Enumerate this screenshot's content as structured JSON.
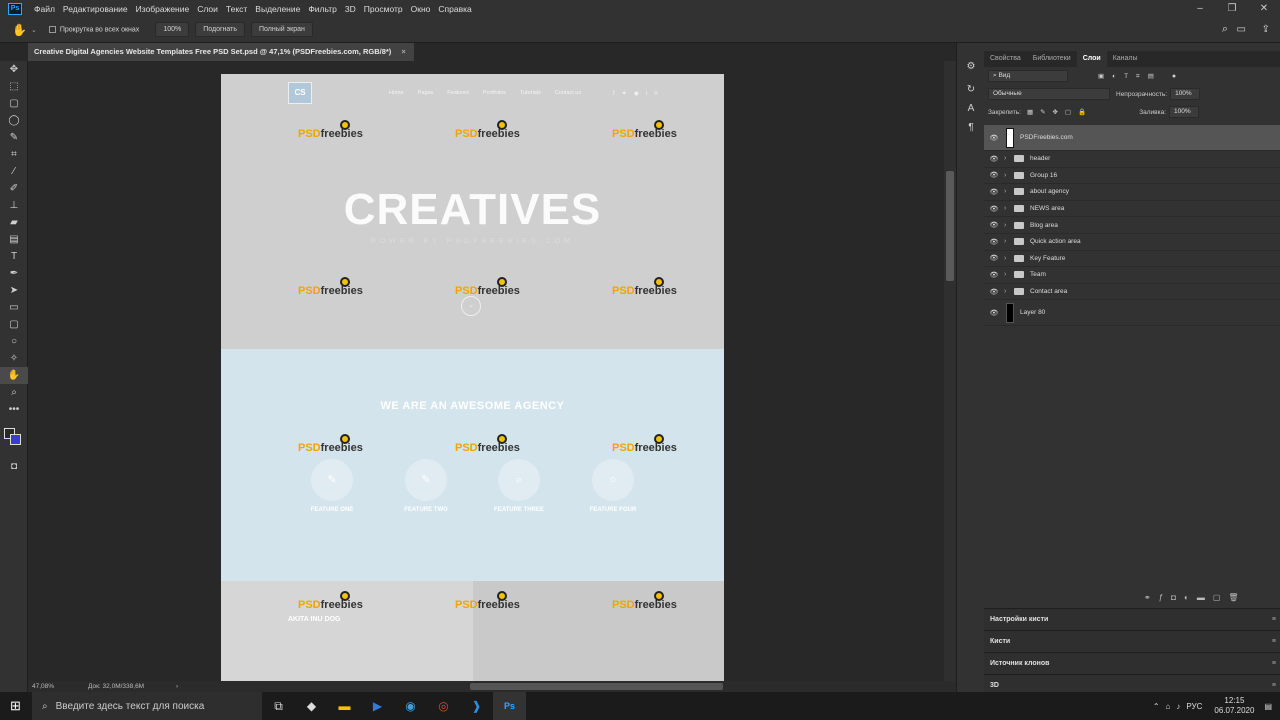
{
  "menu": {
    "items": [
      "Файл",
      "Редактирование",
      "Изображение",
      "Слои",
      "Текст",
      "Выделение",
      "Фильтр",
      "3D",
      "Просмотр",
      "Окно",
      "Справка"
    ]
  },
  "options": {
    "scroll_all": "Прокрутка во всех окнах",
    "zoom": "100%",
    "fit": "Подогнать",
    "fullscreen": "Полный экран"
  },
  "document": {
    "tab_title": "Creative Digital Agencies Website Templates Free PSD Set.psd @ 47,1% (PSDFreebies.com, RGB/8*)",
    "close": "×",
    "nav": [
      "Home",
      "Pages",
      "Features",
      "Portfolios",
      "Tutorials",
      "Contact us"
    ],
    "logo_text": "CS",
    "hero_title": "CREATIVES",
    "hero_sub": "POWER BY PSDFREEBIES.COM",
    "section_title": "WE ARE AN AWESOME AGENCY",
    "features": [
      "FEATURE ONE",
      "FEATURE TWO",
      "FEATURE THREE",
      "FEATURE FOUR"
    ],
    "about_title": "AKITA INU DOG",
    "watermark_p": "PSD",
    "watermark_f": "freebies"
  },
  "status": {
    "zoom": "47,08%",
    "doc_size": "Док: 32,0M/338,6M"
  },
  "panel": {
    "tabs": [
      "Свойства",
      "Библиотеки",
      "Слои",
      "Каналы"
    ],
    "active_tab": "Слои",
    "filter_kind": "Вид",
    "blend_mode": "Обычные",
    "opacity_label": "Непрозрачность:",
    "opacity": "100%",
    "lock_label": "Закрепить:",
    "fill_label": "Заливка:",
    "fill": "100%",
    "layers": [
      {
        "name": "PSDFreebies.com",
        "type": "smart"
      },
      {
        "name": "header",
        "type": "group"
      },
      {
        "name": "Group 16",
        "type": "group"
      },
      {
        "name": "about agency",
        "type": "group"
      },
      {
        "name": "NEWS area",
        "type": "group"
      },
      {
        "name": "Blog area",
        "type": "group"
      },
      {
        "name": "Quick action area",
        "type": "group"
      },
      {
        "name": "Key Feature",
        "type": "group"
      },
      {
        "name": "Team",
        "type": "group"
      },
      {
        "name": "Contact area",
        "type": "group"
      },
      {
        "name": "Layer 80",
        "type": "layer"
      }
    ],
    "collapsed": [
      "Настройки кисти",
      "Кисти",
      "Источник клонов",
      "3D"
    ]
  },
  "taskbar": {
    "search_placeholder": "Введите здесь текст для поиска",
    "lang": "РУС",
    "time": "12:15",
    "date": "06.07.2020"
  },
  "colors": {
    "accent": "#31a8ff",
    "feature_bg": "#d4e4ec",
    "logo_orange": "#f0a500"
  }
}
